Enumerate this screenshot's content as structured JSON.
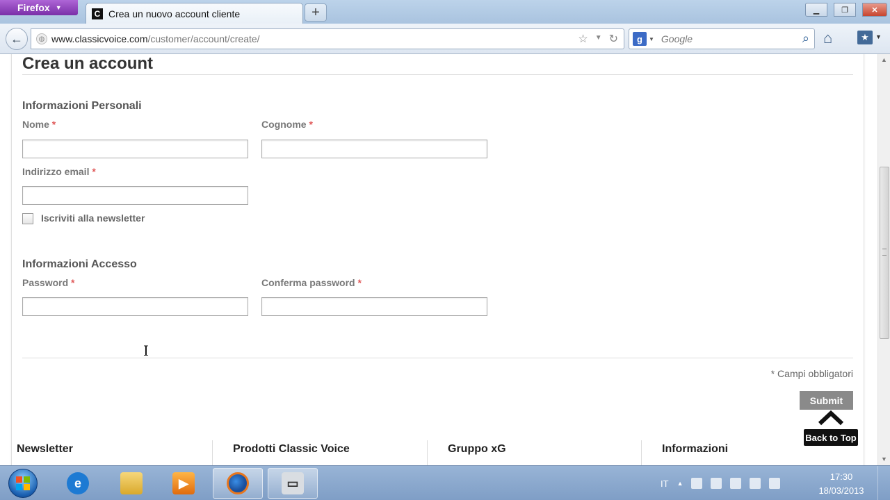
{
  "browser": {
    "app_button": "Firefox",
    "tab_title": "Crea un nuovo account cliente",
    "tab_favicon": "C",
    "url_domain": "www.classicvoice.com",
    "url_path": "/customer/account/create/",
    "search_placeholder": "Google",
    "search_engine_icon": "g"
  },
  "page": {
    "title": "Crea un account",
    "personal_section": "Informazioni Personali",
    "first_name_label": "Nome",
    "last_name_label": "Cognome",
    "email_label": "Indirizzo email",
    "newsletter_label": "Iscriviti alla newsletter",
    "login_section": "Informazioni Accesso",
    "password_label": "Password",
    "confirm_password_label": "Conferma password",
    "required_mark": "*",
    "required_note": "* Campi obbligatori",
    "submit_label": "Submit",
    "back_to_top": "Back to Top"
  },
  "footer": {
    "columns": [
      "Newsletter",
      "Prodotti Classic Voice",
      "Gruppo xG",
      "Informazioni"
    ]
  },
  "taskbar": {
    "language": "IT",
    "time": "17:30",
    "date": "18/03/2013"
  },
  "colors": {
    "required": "#e05a5a",
    "submit_bg": "#8a8a8a",
    "firefox_button": "#7a2fa8"
  }
}
